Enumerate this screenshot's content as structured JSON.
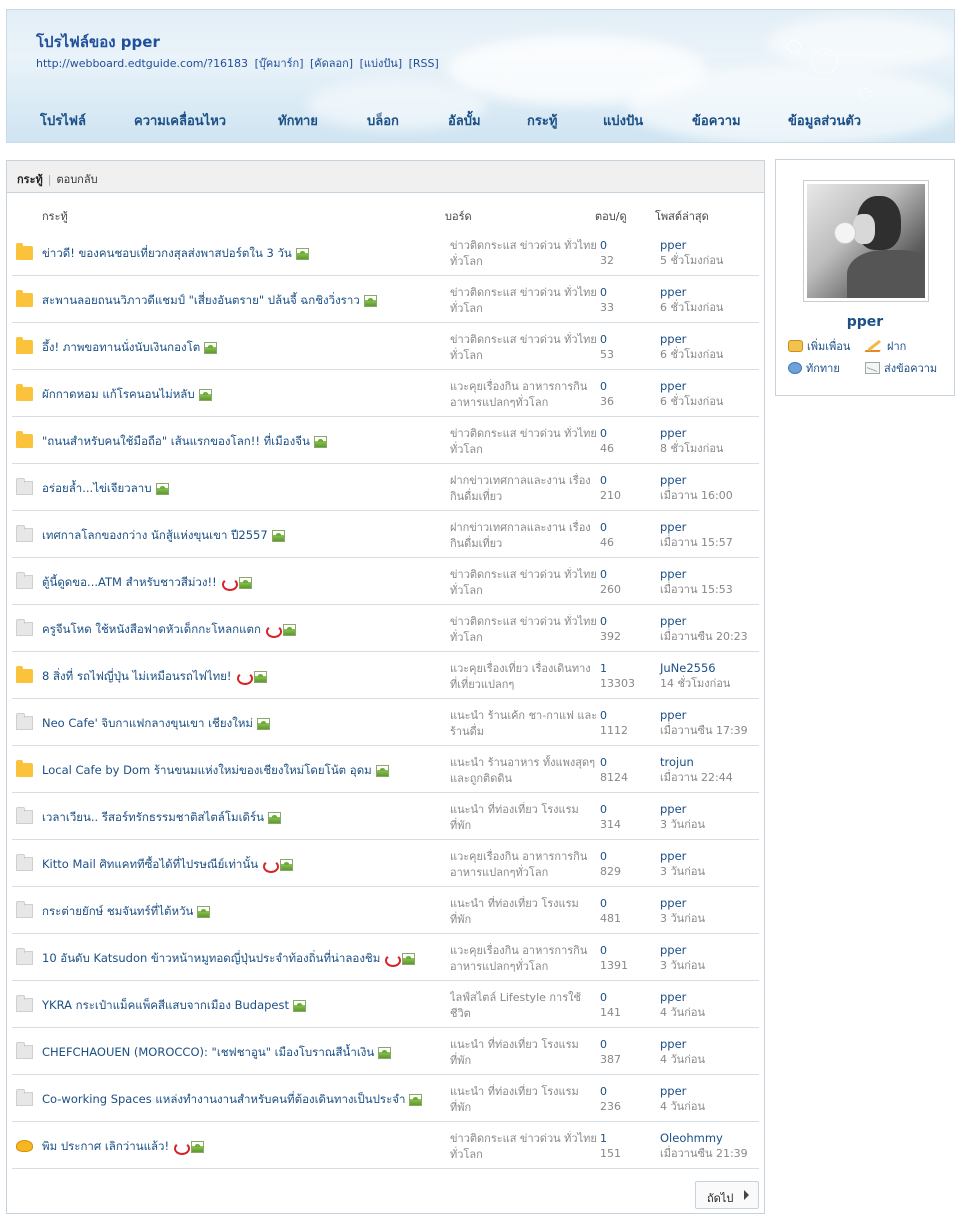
{
  "header": {
    "title": "โปรไฟล์ของ pper",
    "url": "http://webboard.edtguide.com/?16183",
    "links": [
      "[บุ๊คมาร์ก]",
      "[คัดลอก]",
      "[แบ่งปัน]",
      "[RSS]"
    ],
    "nav": [
      "โปรไฟล์",
      "ความเคลื่อนไหว",
      "ทักทาย",
      "บล็อก",
      "อัลบั้ม",
      "กระทู้",
      "แบ่งปัน",
      "ข้อความ",
      "ข้อมูลส่วนตัว"
    ]
  },
  "tabs": {
    "active": "กระทู้",
    "other": "ตอบกลับ"
  },
  "columns": {
    "topic": "กระทู้",
    "board": "บอร์ด",
    "stats": "ตอบ/ดู",
    "last": "โพสต์ล่าสุด"
  },
  "rows": [
    {
      "icon": "folder-yellow",
      "title": "ข่าวดี! ของคนชอบเที่ยวกงสุลส่งพาสปอร์ตใน 3 วัน",
      "hot": false,
      "board": "ข่าวติดกระแส ข่าวด่วน ทั่วไทย ทั่วโลก",
      "replies": "0",
      "views": "32",
      "user": "pper",
      "time": "5 ชั่วโมงก่อน"
    },
    {
      "icon": "folder-yellow",
      "title": "สะพานลอยถนนวิภาวดีแชมป์ \"เสี่ยงอันตราย\" ปล้นจี้ ฉกชิงวิ่งราว",
      "hot": false,
      "board": "ข่าวติดกระแส ข่าวด่วน ทั่วไทย ทั่วโลก",
      "replies": "0",
      "views": "33",
      "user": "pper",
      "time": "6 ชั่วโมงก่อน"
    },
    {
      "icon": "folder-yellow",
      "title": "อึ้ง! ภาพขอทานนั่งนับเงินกองโต",
      "hot": false,
      "board": "ข่าวติดกระแส ข่าวด่วน ทั่วไทย ทั่วโลก",
      "replies": "0",
      "views": "53",
      "user": "pper",
      "time": "6 ชั่วโมงก่อน"
    },
    {
      "icon": "folder-yellow",
      "title": "ผักกาดหอม แก้โรคนอนไม่หลับ",
      "hot": false,
      "board": "แวะคุยเรื่องกิน อาหารการกิน อาหารแปลกๆทั่วโลก",
      "replies": "0",
      "views": "36",
      "user": "pper",
      "time": "6 ชั่วโมงก่อน"
    },
    {
      "icon": "folder-yellow",
      "title": "\"ถนนสำหรับคนใช้มือถือ\" เส้นแรกของโลก!! ที่เมืองจีน",
      "hot": false,
      "board": "ข่าวติดกระแส ข่าวด่วน ทั่วไทย ทั่วโลก",
      "replies": "0",
      "views": "46",
      "user": "pper",
      "time": "8 ชั่วโมงก่อน"
    },
    {
      "icon": "folder-gray",
      "title": "อร่อยล้ำ...ไข่เจียวลาบ",
      "hot": false,
      "board": "ฝากข่าวเทศกาลและงาน เรื่องกินดื่มเที่ยว",
      "replies": "0",
      "views": "210",
      "user": "pper",
      "time": "เมื่อวาน 16:00"
    },
    {
      "icon": "folder-gray",
      "title": "เทศกาลโลกของกว่าง นักสู้แห่งขุนเขา ปี2557",
      "hot": false,
      "board": "ฝากข่าวเทศกาลและงาน เรื่องกินดื่มเที่ยว",
      "replies": "0",
      "views": "46",
      "user": "pper",
      "time": "เมื่อวาน 15:57"
    },
    {
      "icon": "folder-gray",
      "title": "ตู้นี้ดูดขอ...ATM สำหรับชาวสีม่วง!!",
      "hot": true,
      "board": "ข่าวติดกระแส ข่าวด่วน ทั่วไทย ทั่วโลก",
      "replies": "0",
      "views": "260",
      "user": "pper",
      "time": "เมื่อวาน 15:53"
    },
    {
      "icon": "folder-gray",
      "title": "ครูจีนโหด ใช้หนังสือฟาดหัวเด็กกะโหลกแตก",
      "hot": true,
      "board": "ข่าวติดกระแส ข่าวด่วน ทั่วไทย ทั่วโลก",
      "replies": "0",
      "views": "392",
      "user": "pper",
      "time": "เมื่อวานซืน 20:23"
    },
    {
      "icon": "folder-yellow",
      "title": "8 สิ่งที่ รถไฟญี่ปุ่น ไม่เหมือนรถไฟไทย!",
      "hot": true,
      "board": "แวะคุยเรื่องเที่ยว เรื่องเดินทาง ที่เที่ยวแปลกๆ",
      "replies": "1",
      "views": "13303",
      "user": "JuNe2556",
      "time": "14 ชั่วโมงก่อน"
    },
    {
      "icon": "folder-gray",
      "title": "Neo Cafe' จิบกาแฟกลางขุนเขา เชียงใหม่",
      "hot": false,
      "board": "แนะนำ ร้านเค้ก ชา-กาแฟ และร้านดื่ม",
      "replies": "0",
      "views": "1112",
      "user": "pper",
      "time": "เมื่อวานซืน 17:39"
    },
    {
      "icon": "folder-yellow",
      "title": "Local Cafe by Dom ร้านขนมแห่งใหม่ของเชียงใหม่โดยโน้ต อุดม",
      "hot": false,
      "board": "แนะนำ ร้านอาหาร ทั้งแพงสุดๆ และถูกติดดิน",
      "replies": "0",
      "views": "8124",
      "user": "trojun",
      "time": "เมื่อวาน 22:44"
    },
    {
      "icon": "folder-gray",
      "title": "เวลาเวียน.. รีสอร์ทรักธรรมชาติสไตล์โมเดิร์น",
      "hot": false,
      "board": "แนะนำ ที่ท่องเที่ยว โรงแรม ที่พัก",
      "replies": "0",
      "views": "314",
      "user": "pper",
      "time": "3 วันก่อน"
    },
    {
      "icon": "folder-gray",
      "title": "Kitto Mail ศิทแคททีซื้อได้ที่ไปรษณีย์เท่านั้น",
      "hot": true,
      "board": "แวะคุยเรื่องกิน อาหารการกิน อาหารแปลกๆทั่วโลก",
      "replies": "0",
      "views": "829",
      "user": "pper",
      "time": "3 วันก่อน"
    },
    {
      "icon": "folder-gray",
      "title": "กระต่ายยักษ์ ชมจันทร์ที่ไต้หวัน",
      "hot": false,
      "board": "แนะนำ ที่ท่องเที่ยว โรงแรม ที่พัก",
      "replies": "0",
      "views": "481",
      "user": "pper",
      "time": "3 วันก่อน"
    },
    {
      "icon": "folder-gray",
      "title": "10 อันดับ Katsudon ข้าวหน้าหมูทอดญี่ปุ่นประจำท้องถิ่นที่น่าลองชิม",
      "hot": true,
      "board": "แวะคุยเรื่องกิน อาหารการกิน อาหารแปลกๆทั่วโลก",
      "replies": "0",
      "views": "1391",
      "user": "pper",
      "time": "3 วันก่อน"
    },
    {
      "icon": "folder-gray",
      "title": "YKRA กระเป๋าแม็คแพ็คสีแสบจากเมือง Budapest",
      "hot": false,
      "board": "ไลฟ์สไตล์ Lifestyle การใช้ชีวิต",
      "replies": "0",
      "views": "141",
      "user": "pper",
      "time": "4 วันก่อน"
    },
    {
      "icon": "folder-gray",
      "title": "CHEFCHAOUEN (MOROCCO): \"เชฟชาอูน\" เมืองโบราณสีน้ำเงิน",
      "hot": false,
      "board": "แนะนำ ที่ท่องเที่ยว โรงแรม ที่พัก",
      "replies": "0",
      "views": "387",
      "user": "pper",
      "time": "4 วันก่อน"
    },
    {
      "icon": "folder-gray",
      "title": "Co-working Spaces แหล่งทำงานงานสำหรับคนที่ต้องเดินทางเป็นประจำ",
      "hot": false,
      "board": "แนะนำ ที่ท่องเที่ยว โรงแรม ที่พัก",
      "replies": "0",
      "views": "236",
      "user": "pper",
      "time": "4 วันก่อน"
    },
    {
      "icon": "pot",
      "title": "พิม ประกาศ เลิกว่านแล้ว!",
      "hot": true,
      "board": "ข่าวติดกระแส ข่าวด่วน ทั่วไทย ทั่วโลก",
      "replies": "1",
      "views": "151",
      "user": "Oleohmmy",
      "time": "เมื่อวานซืน 21:39"
    }
  ],
  "pager": {
    "next": "ถัดไป"
  },
  "profile": {
    "name": "pper",
    "actions": {
      "add_friend": "เพิ่มเพื่อน",
      "leave": "ฝาก",
      "greet": "ทักทาย",
      "message": "ส่งข้อความ"
    }
  }
}
